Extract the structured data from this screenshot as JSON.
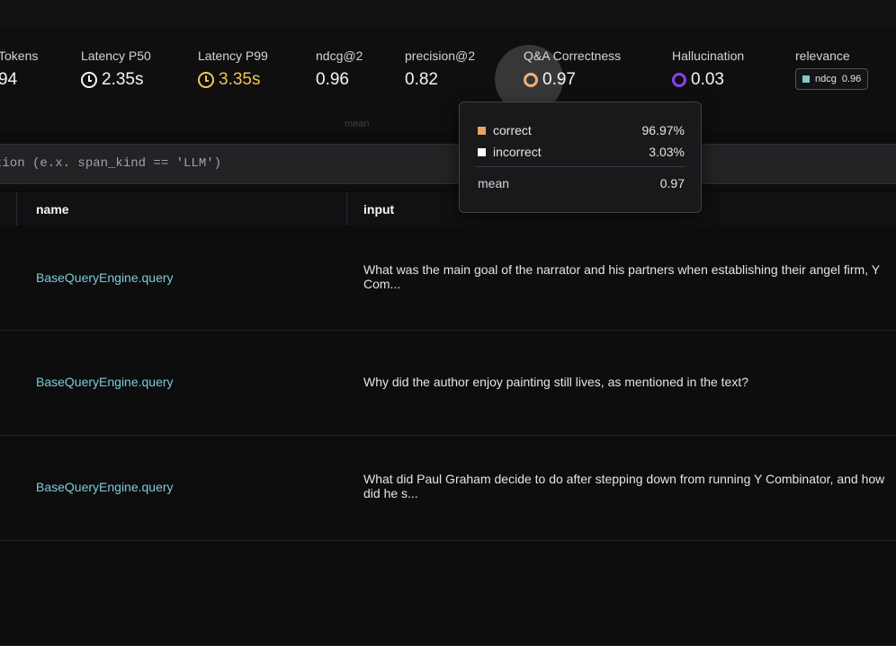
{
  "metrics": {
    "tokens": {
      "label": "Tokens",
      "value": "94"
    },
    "latency_p50": {
      "label": "Latency P50",
      "value": "2.35s",
      "icon": "clock-icon"
    },
    "latency_p99": {
      "label": "Latency P99",
      "value": "3.35s",
      "icon": "clock-icon",
      "color": "#f5c451"
    },
    "ndcg": {
      "label": "ndcg@2",
      "value": "0.96"
    },
    "precision": {
      "label": "precision@2",
      "value": "0.82"
    },
    "qa_correctness": {
      "label": "Q&A Correctness",
      "value": "0.97",
      "icon": "donut-icon",
      "color": "#e9a25f"
    },
    "hallucination": {
      "label": "Hallucination",
      "value": "0.03",
      "icon": "donut-icon",
      "color": "#8b3ff0"
    },
    "relevance": {
      "label": "relevance",
      "chip_label": "ndcg",
      "chip_value": "0.96",
      "chip_color": "#7ec9c9"
    }
  },
  "faint_label": "mean",
  "filter": {
    "text": "tion (e.x. span_kind == 'LLM')"
  },
  "table": {
    "columns": {
      "name": "name",
      "input": "input"
    },
    "rows": [
      {
        "name": "BaseQueryEngine.query",
        "input": "What was the main goal of the narrator and his partners when establishing their angel firm, Y Com..."
      },
      {
        "name": "BaseQueryEngine.query",
        "input": "Why did the author enjoy painting still lives, as mentioned in the text?"
      },
      {
        "name": "BaseQueryEngine.query",
        "input": "What did Paul Graham decide to do after stepping down from running Y Combinator, and how did he s..."
      }
    ]
  },
  "tooltip": {
    "items": [
      {
        "label": "correct",
        "value": "96.97%",
        "color": "#e9a25f"
      },
      {
        "label": "incorrect",
        "value": "3.03%",
        "color": "#ffffff"
      }
    ],
    "mean_label": "mean",
    "mean_value": "0.97"
  }
}
